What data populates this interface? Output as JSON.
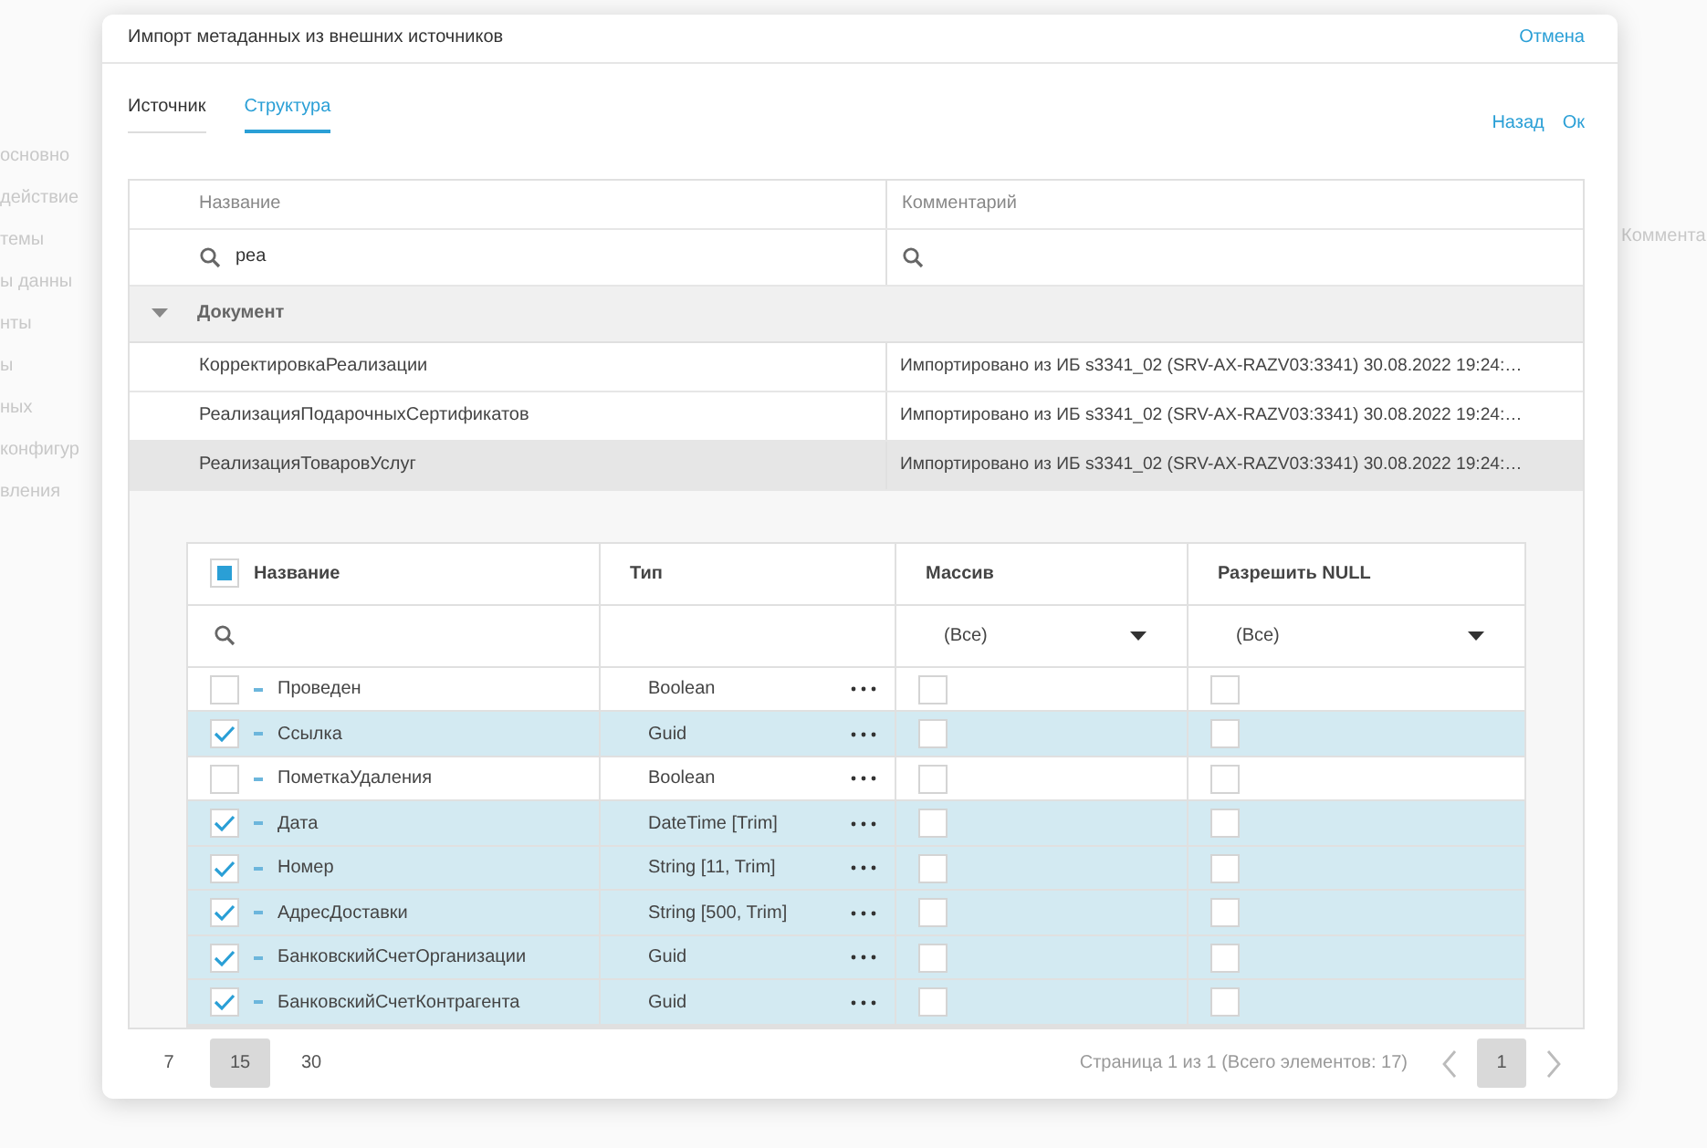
{
  "background": {
    "sidebar_items": [
      "основно",
      "действие",
      "темы",
      "ы данны",
      "нты",
      "ы",
      "ных",
      "конфигур",
      "вления"
    ],
    "column_header": "Коммента"
  },
  "dialog": {
    "title": "Импорт метаданных из внешних источников",
    "cancel": "Отмена"
  },
  "tabs": [
    {
      "label": "Источник",
      "selected": false
    },
    {
      "label": "Структура",
      "selected": true
    }
  ],
  "actions": [
    "Назад",
    "Ок"
  ],
  "objects_table": {
    "columns": [
      "Название",
      "Комментарий"
    ],
    "name_search": "реа",
    "group": {
      "label": "Документ",
      "expanded": true,
      "rows": [
        {
          "name": "КорректировкаРеализации",
          "comment": "Импортировано из ИБ s3341_02 (SRV-AX-RAZV03:3341) 30.08.2022 19:24:…",
          "selected": false
        },
        {
          "name": "РеализацияПодарочныхСертификатов",
          "comment": "Импортировано из ИБ s3341_02 (SRV-AX-RAZV03:3341) 30.08.2022 19:24:…",
          "selected": false
        },
        {
          "name": "РеализацияТоваровУслуг",
          "comment": "Импортировано из ИБ s3341_02 (SRV-AX-RAZV03:3341) 30.08.2022 19:24:…",
          "selected": true
        }
      ]
    }
  },
  "fields_table": {
    "select_all_partial": true,
    "columns": [
      "Название",
      "Тип",
      "Массив",
      "Разрешить NULL"
    ],
    "filters": [
      "(Все)",
      "(Все)"
    ],
    "rows": [
      {
        "name": "Проведен",
        "type": "Boolean",
        "checked": false,
        "array": false,
        "nullable": false
      },
      {
        "name": "Ссылка",
        "type": "Guid",
        "checked": true,
        "array": false,
        "nullable": false
      },
      {
        "name": "ПометкаУдаления",
        "type": "Boolean",
        "checked": false,
        "array": false,
        "nullable": false
      },
      {
        "name": "Дата",
        "type": "DateTime [Trim]",
        "checked": true,
        "array": false,
        "nullable": false
      },
      {
        "name": "Номер",
        "type": "String [11, Trim]",
        "checked": true,
        "array": false,
        "nullable": false
      },
      {
        "name": "АдресДоставки",
        "type": "String [500, Trim]",
        "checked": true,
        "array": false,
        "nullable": false
      },
      {
        "name": "БанковскийСчетОрганизации",
        "type": "Guid",
        "checked": true,
        "array": false,
        "nullable": false
      },
      {
        "name": "БанковскийСчетКонтрагента",
        "type": "Guid",
        "checked": true,
        "array": false,
        "nullable": false
      }
    ]
  },
  "footer": {
    "page_sizes": [
      {
        "label": "7",
        "selected": false
      },
      {
        "label": "15",
        "selected": true
      },
      {
        "label": "30",
        "selected": false
      }
    ],
    "summary": "Страница 1 из 1 (Всего элементов: 17)",
    "pages": [
      {
        "label": "1",
        "selected": true
      }
    ]
  }
}
